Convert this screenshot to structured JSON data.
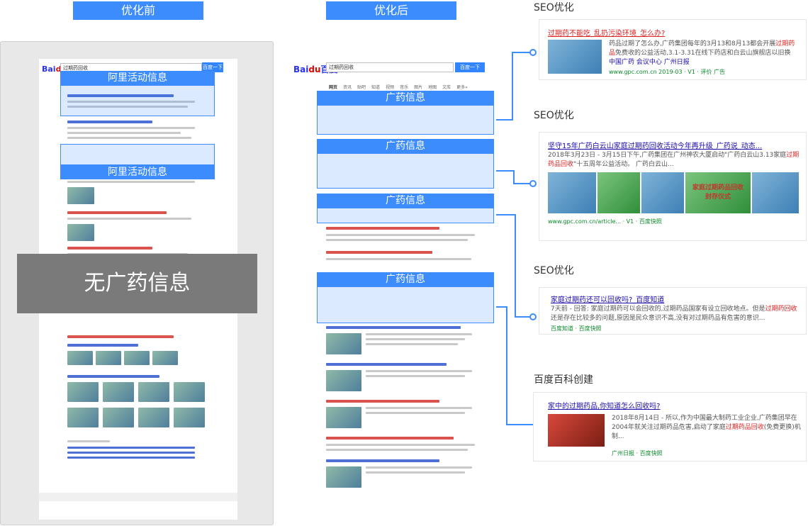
{
  "headers": {
    "before": "优化前",
    "after": "优化后"
  },
  "before": {
    "search_query": "过期药回收",
    "search_button": "百度一下",
    "highlight_1": "阿里活动信息",
    "highlight_2": "阿里活动信息",
    "no_ad_banner": "无广药信息"
  },
  "after": {
    "search_query": "过期药回收",
    "search_button": "百度一下",
    "tabs": [
      "网页",
      "资讯",
      "贴吧",
      "知道",
      "视频",
      "音乐",
      "图片",
      "地图",
      "文库",
      "更多»"
    ],
    "ad_labels": [
      "广药信息",
      "广药信息",
      "广药信息",
      "广药信息"
    ]
  },
  "callouts": [
    {
      "label": "SEO优化",
      "title": "过期药不能吃_乱扔污染环境_怎么办?",
      "text_pre": "药品过期了怎么办,广药集团每年的3月13和8月13都会开展",
      "text_red": "过期药品",
      "text_post": "免费收的公益活动,3.1-3.31在线下药店和白云山旗舰店以旧换新...",
      "links": [
        "中国广药",
        "会议中心",
        "广州日报"
      ],
      "source": "www.gpc.com.cn  2019-03  ·  V1  ·  评价  广告"
    },
    {
      "label": "SEO优化",
      "title": "坚守15年广药白云山家庭过期药回收活动今年再升级_广药说_动态...",
      "text_pre": "2018年3月23日 - 3月15日下午,广药集团在广州神农大厦启动\"广药白云山3.13家庭",
      "text_red": "过期药品回收",
      "text_post": "\"十五周年公益活动。 广药白云山...",
      "banner": "家庭过期药品回收 封存仪式",
      "source": "www.gpc.com.cn/article...  ·  V1  ·  百度快照"
    },
    {
      "label": "SEO优化",
      "title": "家庭过期药还可以回收吗?_百度知道",
      "text_pre": "7天前 - 回答: 家庭过期药可以会回收的,过期药品国家有设立回收地点。但是",
      "text_red": "过期药回收",
      "text_post": "还是存在比较多的问题,原因是民众意识不高,没有对过期药品有危害的意识...",
      "source": "百度知道  ·  百度快照"
    },
    {
      "label": "百度百科创建",
      "title": "家中的过期药品,你知道怎么回收吗?",
      "text_pre": "2018年8月14日 - 所以,作为中国最大制药工业企业,广药集团早在2004年就关注过期药品危害,启动了家庭",
      "text_red": "过期药品回收",
      "text_post": "(免费更换)机制...",
      "source": "广州日报  ·  百度快照"
    }
  ]
}
